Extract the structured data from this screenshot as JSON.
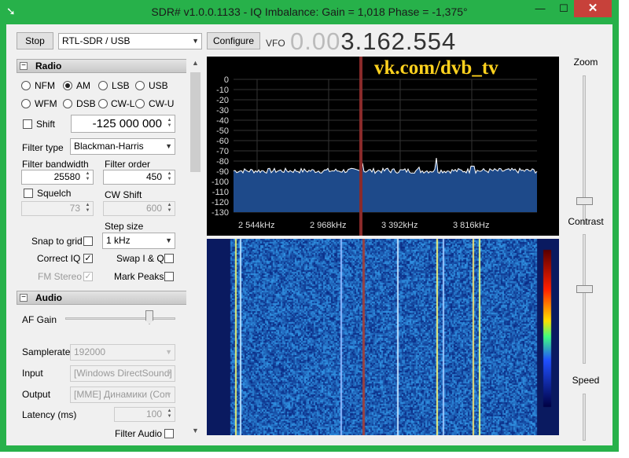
{
  "window": {
    "title": "SDR# v1.0.0.1133 - IQ Imbalance: Gain = 1,018 Phase = -1,375°",
    "minimize": "—",
    "maximize": "☐",
    "close": "✕",
    "app_icon": "sdr-icon"
  },
  "toolbar": {
    "stop_label": "Stop",
    "source_value": "RTL-SDR / USB",
    "configure_label": "Configure",
    "vfo_label": "VFO",
    "vfo_dim": "0.00",
    "vfo_value": "3.162.554"
  },
  "radio": {
    "header": "Radio",
    "modes": [
      {
        "label": "NFM",
        "selected": false
      },
      {
        "label": "AM",
        "selected": true
      },
      {
        "label": "LSB",
        "selected": false
      },
      {
        "label": "USB",
        "selected": false
      },
      {
        "label": "WFM",
        "selected": false
      },
      {
        "label": "DSB",
        "selected": false
      },
      {
        "label": "CW-L",
        "selected": false
      },
      {
        "label": "CW-U",
        "selected": false
      }
    ],
    "shift_label": "Shift",
    "shift_value": "-125 000 000",
    "filter_type_label": "Filter type",
    "filter_type_value": "Blackman-Harris",
    "filter_bandwidth_label": "Filter bandwidth",
    "filter_bandwidth_value": "25580",
    "filter_order_label": "Filter order",
    "filter_order_value": "450",
    "squelch_label": "Squelch",
    "squelch_value": "73",
    "cw_shift_label": "CW Shift",
    "cw_shift_value": "600",
    "step_size_label": "Step size",
    "step_size_value": "1 kHz",
    "snap_label": "Snap to grid",
    "correct_iq_label": "Correct IQ",
    "swap_iq_label": "Swap I & Q",
    "fm_stereo_label": "FM Stereo",
    "mark_peaks_label": "Mark Peaks"
  },
  "audio": {
    "header": "Audio",
    "af_gain_label": "AF Gain",
    "samplerate_label": "Samplerate",
    "samplerate_value": "192000",
    "input_label": "Input",
    "input_value": "[Windows DirectSound]",
    "output_label": "Output",
    "output_value": "[MME] Динамики (Con",
    "latency_label": "Latency (ms)",
    "latency_value": "100",
    "filter_audio_label": "Filter Audio"
  },
  "right_panel": {
    "zoom_label": "Zoom",
    "contrast_label": "Contrast",
    "speed_label": "Speed"
  },
  "spectrum": {
    "watermark": "vk.com/dvb_tv",
    "db_ticks": [
      "0",
      "-10",
      "-20",
      "-30",
      "-40",
      "-50",
      "-60",
      "-70",
      "-80",
      "-90",
      "-100",
      "-110",
      "-120",
      "-130"
    ],
    "freq_ticks": [
      "2 544kHz",
      "2 968kHz",
      "3 392kHz",
      "3 816kHz"
    ],
    "trace_color": "#ffffff",
    "fill_color": "#1e4a8a",
    "marker_color": "#8a2a2a"
  }
}
